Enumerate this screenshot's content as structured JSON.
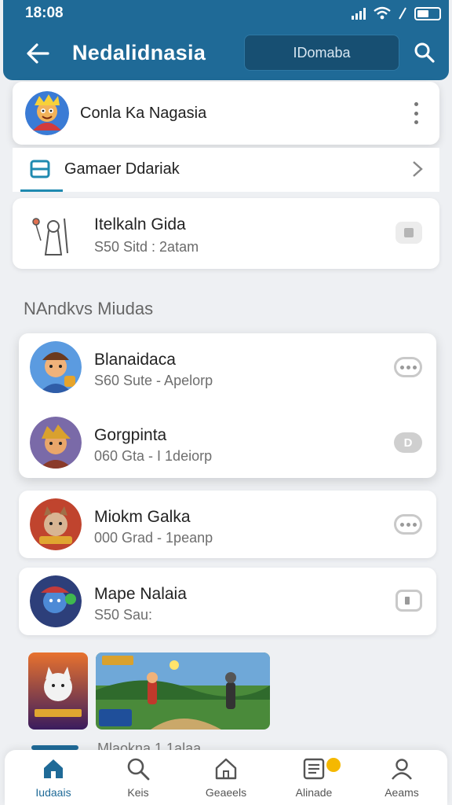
{
  "status_bar": {
    "time": "18:08"
  },
  "header": {
    "title": "Nedalidnasia",
    "domain_placeholder": "IDomaba",
    "back_icon": "arrow-left-icon",
    "search_icon": "search-icon"
  },
  "profile": {
    "name": "Conla Ka Nagasia"
  },
  "section_row": {
    "label": "Gamaer Ddariak"
  },
  "featured": {
    "title": "Itelkaln Gida",
    "subtitle": "S50 Sitd : 2atam"
  },
  "list_header": "NAndkvs Miudas",
  "list_group": [
    {
      "title": "Blanaidaca",
      "subtitle": "S60 Sute - Apelorp",
      "action": "more"
    },
    {
      "title": "Gorgpinta",
      "subtitle": "060 Gta - I 1deiorp",
      "action": "D"
    }
  ],
  "single_items": [
    {
      "title": "Miokm Galka",
      "subtitle": "000 Grad - 1peanp",
      "action": "more"
    },
    {
      "title": "Mape Nalaia",
      "subtitle": "S50 Sau:",
      "action": "toggle"
    }
  ],
  "peek_text": "Mlaokna 1 1alaa",
  "bottom_nav": [
    {
      "label": "Iudaais",
      "icon": "home-icon",
      "active": true
    },
    {
      "label": "Keis",
      "icon": "search-icon",
      "active": false
    },
    {
      "label": "Geaeels",
      "icon": "house-outline-icon",
      "active": false
    },
    {
      "label": "Alinade",
      "icon": "list-icon",
      "active": false
    },
    {
      "label": "Aeams",
      "icon": "profile-icon",
      "active": false
    }
  ],
  "colors": {
    "brand": "#1f6a97",
    "badge": "#f5b800"
  }
}
